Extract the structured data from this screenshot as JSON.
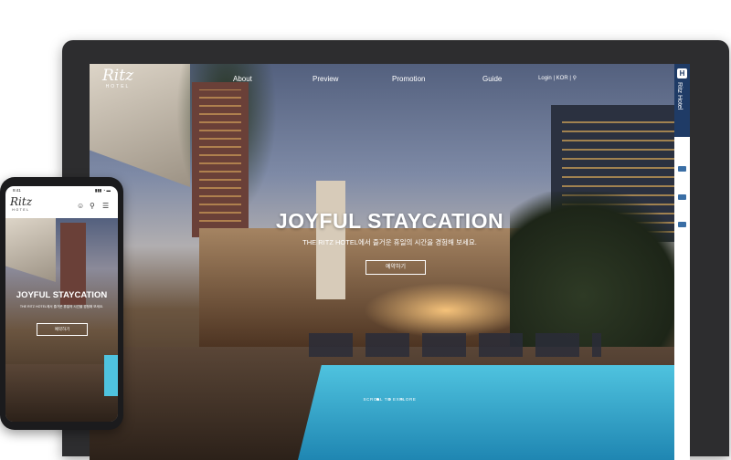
{
  "brand": {
    "name": "Ritz",
    "sub": "HOTEL",
    "sidebar_name": "Ritz Hotel",
    "sidebar_badge": "H"
  },
  "nav": {
    "items": [
      "About",
      "Preview",
      "Promotion",
      "Guide"
    ],
    "login": "Login",
    "lang": "KOR"
  },
  "hero": {
    "title": "JOYFUL STAYCATION",
    "subtitle": "THE RITZ HOTEL에서 즐거운 휴일의 시간을 경험해 보세요.",
    "button": "예약하기",
    "scroll": "SCROLL TO EXPLORE",
    "slides": 3,
    "active_slide": 1
  },
  "mobile": {
    "time": "9:41",
    "signal": "▮▮▮ ◔ ▬",
    "title": "JOYFUL STAYCATION",
    "subtitle": "THE RITZ HOTEL에서 즐거운 휴일의 시간을 경험해 보세요.",
    "button": "예약하기",
    "icons": [
      "user-icon",
      "search-icon",
      "menu-icon"
    ]
  },
  "colors": {
    "sidebar_brand": "#1f3b66",
    "sidebar_icon": "#3a6ea5",
    "frame": "#2d2d2f",
    "pool": "#4fc3df"
  }
}
